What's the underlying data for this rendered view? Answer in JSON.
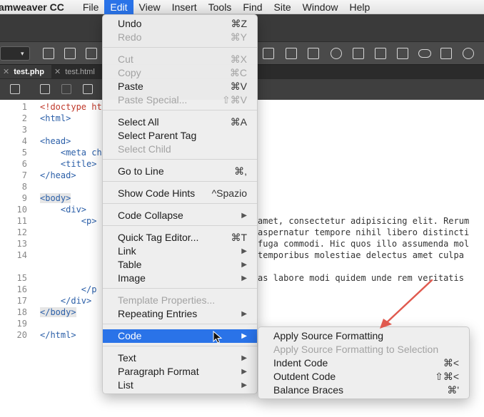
{
  "menubar": {
    "app": "amweaver CC",
    "items": [
      "File",
      "Edit",
      "View",
      "Insert",
      "Tools",
      "Find",
      "Site",
      "Window",
      "Help"
    ],
    "active_index": 1
  },
  "toolbar": {
    "icons": [
      "folder-icon",
      "download-icon",
      "upload-icon"
    ]
  },
  "tabs": [
    {
      "label": "test.php",
      "active": true
    },
    {
      "label": "test.html",
      "active": false
    }
  ],
  "code": {
    "lines": [
      {
        "n": "1",
        "text": "<!doctype ht"
      },
      {
        "n": "2",
        "text": "<html>"
      },
      {
        "n": "3",
        "text": ""
      },
      {
        "n": "4",
        "text": "<head>"
      },
      {
        "n": "5",
        "text": "    <meta ch"
      },
      {
        "n": "6",
        "text": "    <title>"
      },
      {
        "n": "7",
        "text": "</head>"
      },
      {
        "n": "8",
        "text": ""
      },
      {
        "n": "9",
        "text": "<body>"
      },
      {
        "n": "10",
        "text": "    <div>"
      },
      {
        "n": "11",
        "text": "        <p>"
      },
      {
        "n": "12",
        "text": ""
      },
      {
        "n": "13",
        "text": ""
      },
      {
        "n": "14",
        "text": ""
      },
      {
        "n": "15",
        "text": ""
      },
      {
        "n": "16",
        "text": "        </p"
      },
      {
        "n": "17",
        "text": "    </div>"
      },
      {
        "n": "18",
        "text": "</body>"
      },
      {
        "n": "19",
        "text": ""
      },
      {
        "n": "20",
        "text": "</html>"
      }
    ],
    "visible_right": [
      "amet, consectetur adipisicing elit. Rerum",
      "aspernatur tempore nihil libero distincti",
      "fuga commodi. Hic quos illo assumenda mol",
      "temporibus molestiae delectus amet culpa",
      "as labore modi quidem unde rem veritatis"
    ]
  },
  "edit_menu": {
    "items": [
      {
        "label": "Undo",
        "shortcut": "⌘Z",
        "disabled": false
      },
      {
        "label": "Redo",
        "shortcut": "⌘Y",
        "disabled": true
      },
      {
        "label": "Cut",
        "shortcut": "⌘X",
        "disabled": true
      },
      {
        "label": "Copy",
        "shortcut": "⌘C",
        "disabled": true
      },
      {
        "label": "Paste",
        "shortcut": "⌘V",
        "disabled": false
      },
      {
        "label": "Paste Special...",
        "shortcut": "⇧⌘V",
        "disabled": true
      },
      {
        "label": "Select All",
        "shortcut": "⌘A",
        "disabled": false
      },
      {
        "label": "Select Parent Tag",
        "shortcut": "",
        "disabled": false
      },
      {
        "label": "Select Child",
        "shortcut": "",
        "disabled": true
      },
      {
        "label": "Go to Line",
        "shortcut": "⌘,",
        "disabled": false
      },
      {
        "label": "Show Code Hints",
        "shortcut": "^Spazio",
        "disabled": false
      },
      {
        "label": "Code Collapse",
        "shortcut": "",
        "disabled": false
      },
      {
        "label": "Quick Tag Editor...",
        "shortcut": "⌘T",
        "disabled": false
      },
      {
        "label": "Link",
        "shortcut": "",
        "disabled": false
      },
      {
        "label": "Table",
        "shortcut": "",
        "disabled": false
      },
      {
        "label": "Image",
        "shortcut": "",
        "disabled": false
      },
      {
        "label": "Template Properties...",
        "shortcut": "",
        "disabled": true
      },
      {
        "label": "Repeating Entries",
        "shortcut": "",
        "disabled": false
      },
      {
        "label": "Code",
        "shortcut": "",
        "disabled": false
      },
      {
        "label": "Text",
        "shortcut": "",
        "disabled": false
      },
      {
        "label": "Paragraph Format",
        "shortcut": "",
        "disabled": false
      },
      {
        "label": "List",
        "shortcut": "",
        "disabled": false
      }
    ]
  },
  "code_submenu": {
    "items": [
      {
        "label": "Apply Source Formatting",
        "shortcut": "",
        "disabled": false
      },
      {
        "label": "Apply Source Formatting to Selection",
        "shortcut": "",
        "disabled": true
      },
      {
        "label": "Indent Code",
        "shortcut": "⌘<",
        "disabled": false
      },
      {
        "label": "Outdent Code",
        "shortcut": "⇧⌘<",
        "disabled": false
      },
      {
        "label": "Balance Braces",
        "shortcut": "⌘'",
        "disabled": false
      }
    ]
  },
  "colors": {
    "menu_highlight": "#2a73e8",
    "annotation_arrow": "#e05a4f"
  }
}
